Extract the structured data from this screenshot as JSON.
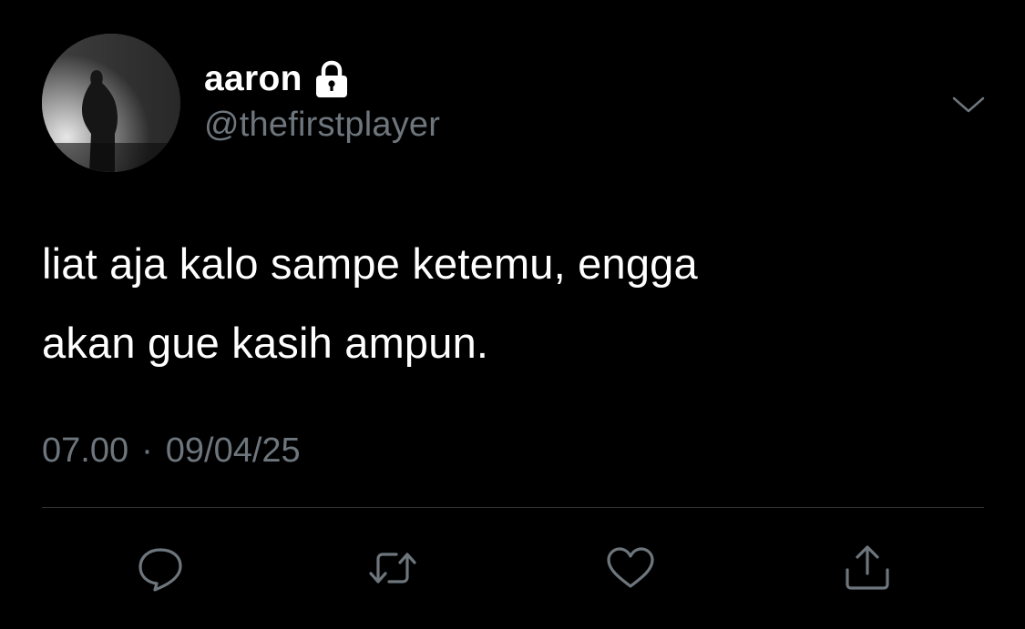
{
  "user": {
    "display_name": "aaron",
    "handle": "@thefirstplayer",
    "protected_icon": "lock-icon"
  },
  "tweet": {
    "text": "liat aja kalo sampe ketemu, engga\nakan gue kasih ampun.",
    "time": "07.00",
    "separator": "·",
    "date": "09/04/25"
  },
  "actions": [
    {
      "name": "reply",
      "icon": "speech-bubble-icon"
    },
    {
      "name": "retweet",
      "icon": "retweet-arrows-icon"
    },
    {
      "name": "like",
      "icon": "heart-icon"
    },
    {
      "name": "share",
      "icon": "share-upload-icon"
    }
  ],
  "colors": {
    "background": "#000000",
    "primary_text": "#ffffff",
    "secondary_text": "#6e767d",
    "divider": "#2f3336",
    "icon": "#6e767d"
  }
}
